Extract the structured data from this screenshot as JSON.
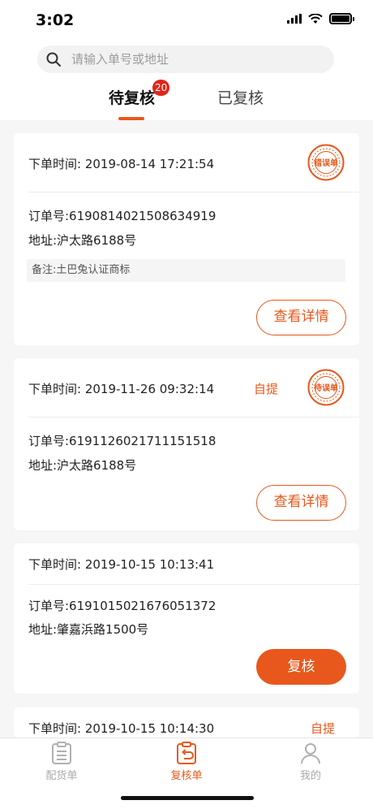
{
  "status_bar": {
    "time": "3:02"
  },
  "search": {
    "placeholder": "请输入单号或地址"
  },
  "tabs": [
    {
      "label": "待复核",
      "badge": "20"
    },
    {
      "label": "已复核"
    }
  ],
  "orders": [
    {
      "time": "下单时间: 2019-08-14 17:21:54",
      "order_no": "订单号:6190814021508634919",
      "address": "地址:沪太路6188号",
      "note": "备注:土巴兔认证商标",
      "stamp": "错误单",
      "button": "查看详情"
    },
    {
      "time": "下单时间: 2019-11-26 09:32:14",
      "tag": "自提",
      "order_no": "订单号:6191126021711151518",
      "address": "地址:沪太路6188号",
      "stamp": "待误单",
      "button": "查看详情"
    },
    {
      "time": "下单时间: 2019-10-15 10:13:41",
      "order_no": "订单号:6191015021676051372",
      "address": "地址:肇嘉浜路1500号",
      "button": "复核"
    },
    {
      "time": "下单时间: 2019-10-15 10:14:30",
      "tag": "自提"
    }
  ],
  "tabbar": [
    {
      "label": "配货单",
      "icon": "clipboard-list-icon"
    },
    {
      "label": "复核单",
      "icon": "clipboard-return-icon"
    },
    {
      "label": "我的",
      "icon": "user-icon"
    }
  ],
  "colors": {
    "accent": "#e8581c",
    "badge": "#e0261b"
  }
}
